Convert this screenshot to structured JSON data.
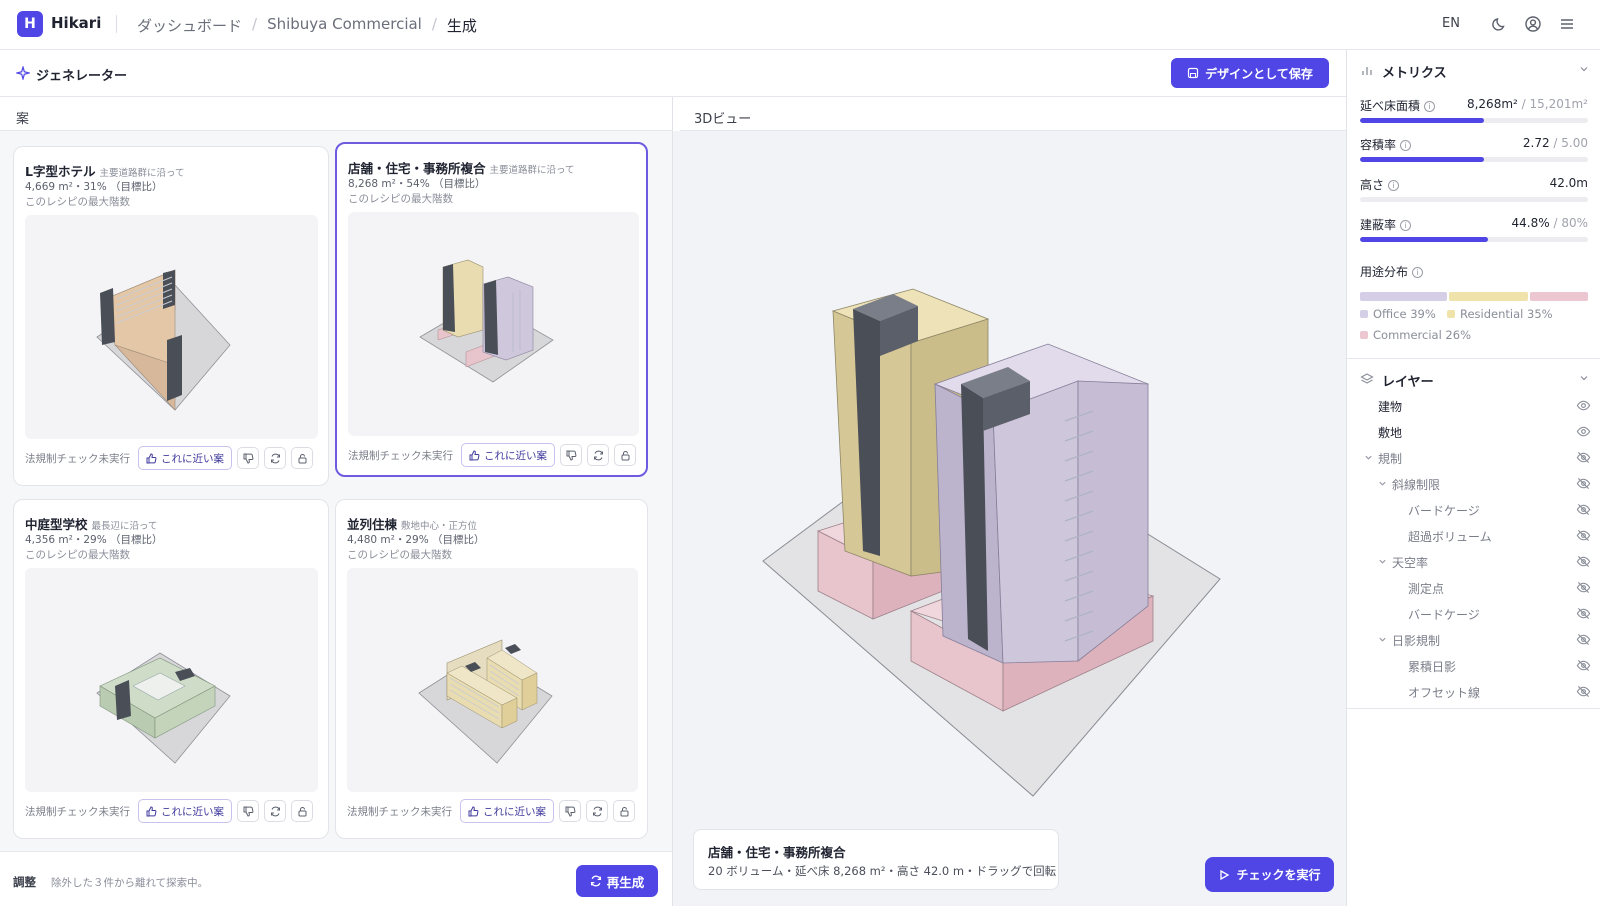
{
  "app": {
    "logo_letter": "H",
    "name": "Hikari"
  },
  "breadcrumb": [
    "ダッシュボード",
    "Shibuya Commercial",
    "生成"
  ],
  "topbar": {
    "lang": "EN",
    "icons": [
      "moon-icon",
      "user-icon",
      "menu-icon"
    ]
  },
  "generator": {
    "title": "ジェネレーター",
    "save_label": "デザインとして保存"
  },
  "panes": {
    "proposals": "案",
    "view3d": "3Dビュー"
  },
  "cards": [
    {
      "title": "L字型ホテル",
      "tag": "主要道路群に沿って",
      "metrics": "4,669 m²・31% （目標比）",
      "recipe": "このレシピの最大階数",
      "law": "法規制チェック未実行",
      "near": "これに近い案",
      "selected": false
    },
    {
      "title": "店舗・住宅・事務所複合",
      "tag": "主要道路群に沿って",
      "metrics": "8,268 m²・54% （目標比）",
      "recipe": "このレシピの最大階数",
      "law": "法規制チェック未実行",
      "near": "これに近い案",
      "selected": true
    },
    {
      "title": "中庭型学校",
      "tag": "最長辺に沿って",
      "metrics": "4,356 m²・29% （目標比）",
      "recipe": "このレシピの最大階数",
      "law": "法規制チェック未実行",
      "near": "これに近い案",
      "selected": false
    },
    {
      "title": "並列住棟",
      "tag": "敷地中心・正方位",
      "metrics": "4,480 m²・29% （目標比）",
      "recipe": "このレシピの最大階数",
      "law": "法規制チェック未実行",
      "near": "これに近い案",
      "selected": false
    }
  ],
  "adjust": {
    "label": "調整",
    "desc": "除外した３件から離れて探索中。",
    "regen_label": "再生成"
  },
  "view": {
    "title": "店舗・住宅・事務所複合",
    "summary": "20 ボリューム・延べ床 8,268 m²・高さ 42.0 m・ドラッグで回転",
    "check_label": "チェックを実行"
  },
  "metrics": {
    "title": "メトリクス",
    "items": [
      {
        "label": "延べ床面積",
        "value": "8,268m²",
        "max": " / 15,201m²",
        "fill": 0.544
      },
      {
        "label": "容積率",
        "value": "2.72",
        "max": " / 5.00",
        "fill": 0.544
      },
      {
        "label": "高さ",
        "value": "42.0m",
        "max": "",
        "fill": 0
      },
      {
        "label": "建蔽率",
        "value": "44.8%",
        "max": " / 80%",
        "fill": 0.56
      }
    ],
    "use_title": "用途分布",
    "use": [
      {
        "label": "Office 39%",
        "share": 0.39,
        "color": "#d4cfe6"
      },
      {
        "label": "Residential 35%",
        "share": 0.35,
        "color": "#efe2ab"
      },
      {
        "label": "Commercial 26%",
        "share": 0.26,
        "color": "#ecc7d1"
      }
    ]
  },
  "layers": {
    "title": "レイヤー",
    "items": [
      {
        "label": "建物",
        "indent": 0,
        "arrow": false,
        "visible": true
      },
      {
        "label": "敷地",
        "indent": 0,
        "arrow": false,
        "visible": true
      },
      {
        "label": "規制",
        "indent": 0,
        "arrow": true,
        "visible": false
      },
      {
        "label": "斜線制限",
        "indent": 1,
        "arrow": true,
        "visible": false
      },
      {
        "label": "バードケージ",
        "indent": 2,
        "arrow": false,
        "visible": false
      },
      {
        "label": "超過ボリューム",
        "indent": 2,
        "arrow": false,
        "visible": false
      },
      {
        "label": "天空率",
        "indent": 1,
        "arrow": true,
        "visible": false
      },
      {
        "label": "測定点",
        "indent": 2,
        "arrow": false,
        "visible": false
      },
      {
        "label": "バードケージ",
        "indent": 2,
        "arrow": false,
        "visible": false
      },
      {
        "label": "日影規制",
        "indent": 1,
        "arrow": true,
        "visible": false
      },
      {
        "label": "累積日影",
        "indent": 2,
        "arrow": false,
        "visible": false
      },
      {
        "label": "オフセット線",
        "indent": 2,
        "arrow": false,
        "visible": false
      }
    ]
  },
  "colors": {
    "accent": "#4f46e5",
    "selected_border": "#6d5ce0"
  }
}
